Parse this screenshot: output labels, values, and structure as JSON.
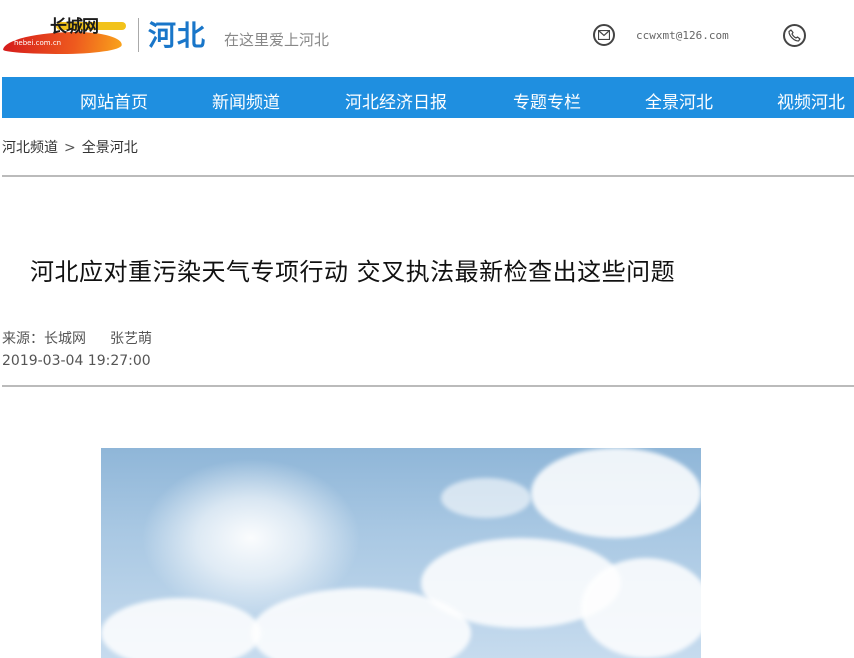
{
  "header": {
    "logo_text": "长城网",
    "logo_domain": "hebei.com.cn",
    "region": "河北",
    "slogan": "在这里爱上河北",
    "email": "ccwxmt@126.com"
  },
  "nav": {
    "items": [
      "网站首页",
      "新闻频道",
      "河北经济日报",
      "专题专栏",
      "全景河北",
      "视频河北"
    ]
  },
  "breadcrumb": {
    "items": [
      "河北频道",
      "全景河北"
    ],
    "separator": ">"
  },
  "article": {
    "title": "河北应对重污染天气专项行动  交叉执法最新检查出这些问题",
    "source_label": "来源：",
    "source": "长城网",
    "author": "张艺萌",
    "datetime": "2019-03-04 19:27:00"
  },
  "colors": {
    "nav_bg": "#1f8fe0",
    "region_text": "#1976c9"
  },
  "icons": [
    "mail-icon",
    "phone-icon"
  ]
}
